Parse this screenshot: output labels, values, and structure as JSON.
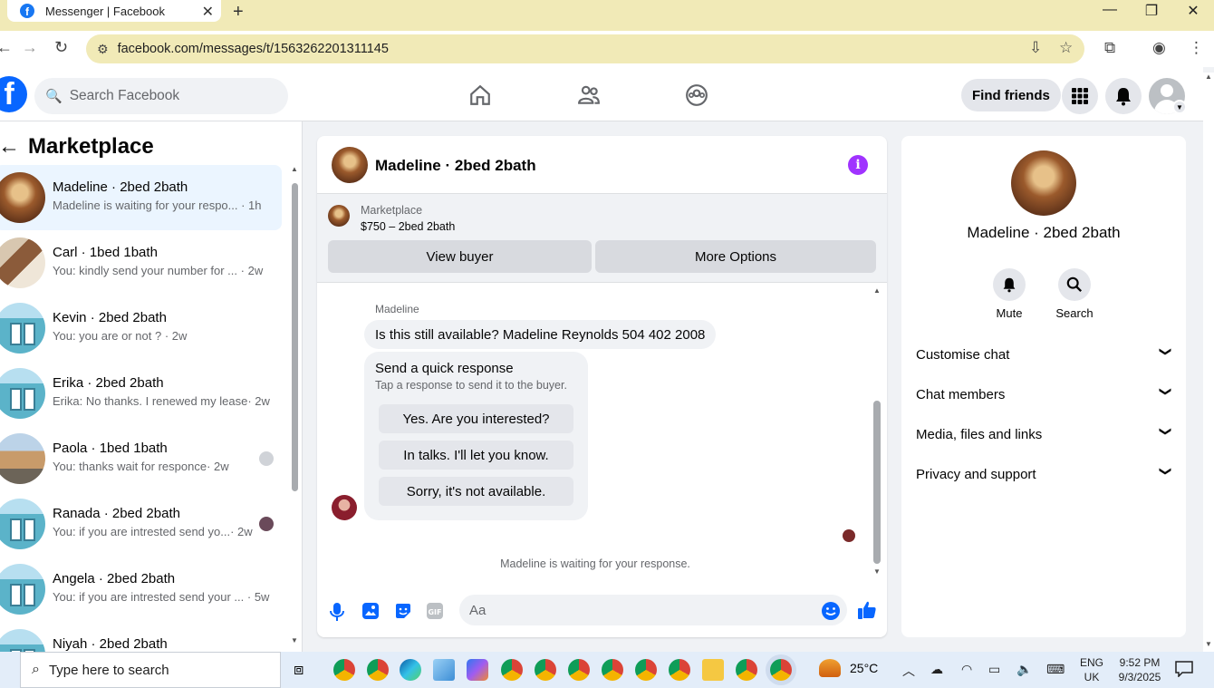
{
  "browser": {
    "tab_title": "Messenger | Facebook",
    "url": "facebook.com/messages/t/1563262201311145"
  },
  "fb": {
    "search_placeholder": "Search Facebook",
    "find_friends": "Find friends"
  },
  "left": {
    "title": "Marketplace",
    "conversations": [
      {
        "name": "Madeline · 2bed 2bath",
        "preview": "Madeline is waiting for your respo...",
        "time": "· 1h"
      },
      {
        "name": "Carl · 1bed 1bath",
        "preview": "You: kindly send your number for ...",
        "time": "· 2w"
      },
      {
        "name": "Kevin · 2bed 2bath",
        "preview": "You: you are or not ?",
        "time": "· 2w"
      },
      {
        "name": "Erika · 2bed 2bath",
        "preview": "Erika: No thanks. I renewed my lease",
        "time": "· 2w"
      },
      {
        "name": "Paola · 1bed 1bath",
        "preview": "You: thanks wait for responce",
        "time": "· 2w"
      },
      {
        "name": "Ranada · 2bed 2bath",
        "preview": "You: if you are intrested send yo...",
        "time": "· 2w"
      },
      {
        "name": "Angela · 2bed 2bath",
        "preview": "You: if you are intrested send your ...",
        "time": "· 5w"
      },
      {
        "name": "Niyah · 2bed 2bath",
        "preview": "",
        "time": ""
      }
    ]
  },
  "chat": {
    "title": "Madeline · 2bed 2bath",
    "marketplace_label": "Marketplace",
    "listing": "$750 – 2bed 2bath",
    "view_buyer": "View buyer",
    "more_options": "More Options",
    "sender": "Madeline",
    "message": "Is this still available? Madeline Reynolds 504 402 2008",
    "quick_title": "Send a quick response",
    "quick_sub": "Tap a response to send it to the buyer.",
    "quick_replies": [
      "Yes. Are you interested?",
      "In talks. I'll let you know.",
      "Sorry, it's not available."
    ],
    "waiting": "Madeline is waiting for your response.",
    "input_placeholder": "Aa"
  },
  "right": {
    "name": "Madeline · 2bed 2bath",
    "mute": "Mute",
    "search": "Search",
    "sections": [
      "Customise chat",
      "Chat members",
      "Media, files and links",
      "Privacy and support"
    ]
  },
  "taskbar": {
    "search_placeholder": "Type here to search",
    "temperature": "25°C",
    "lang1": "ENG",
    "lang2": "UK",
    "time": "9:52 PM",
    "date": "9/3/2025"
  },
  "colors": {
    "fb_blue": "#0866ff",
    "messenger_purple": "#a033ff",
    "active_conv_bg": "#ebf5ff",
    "tab_bar": "#f1eab7"
  }
}
